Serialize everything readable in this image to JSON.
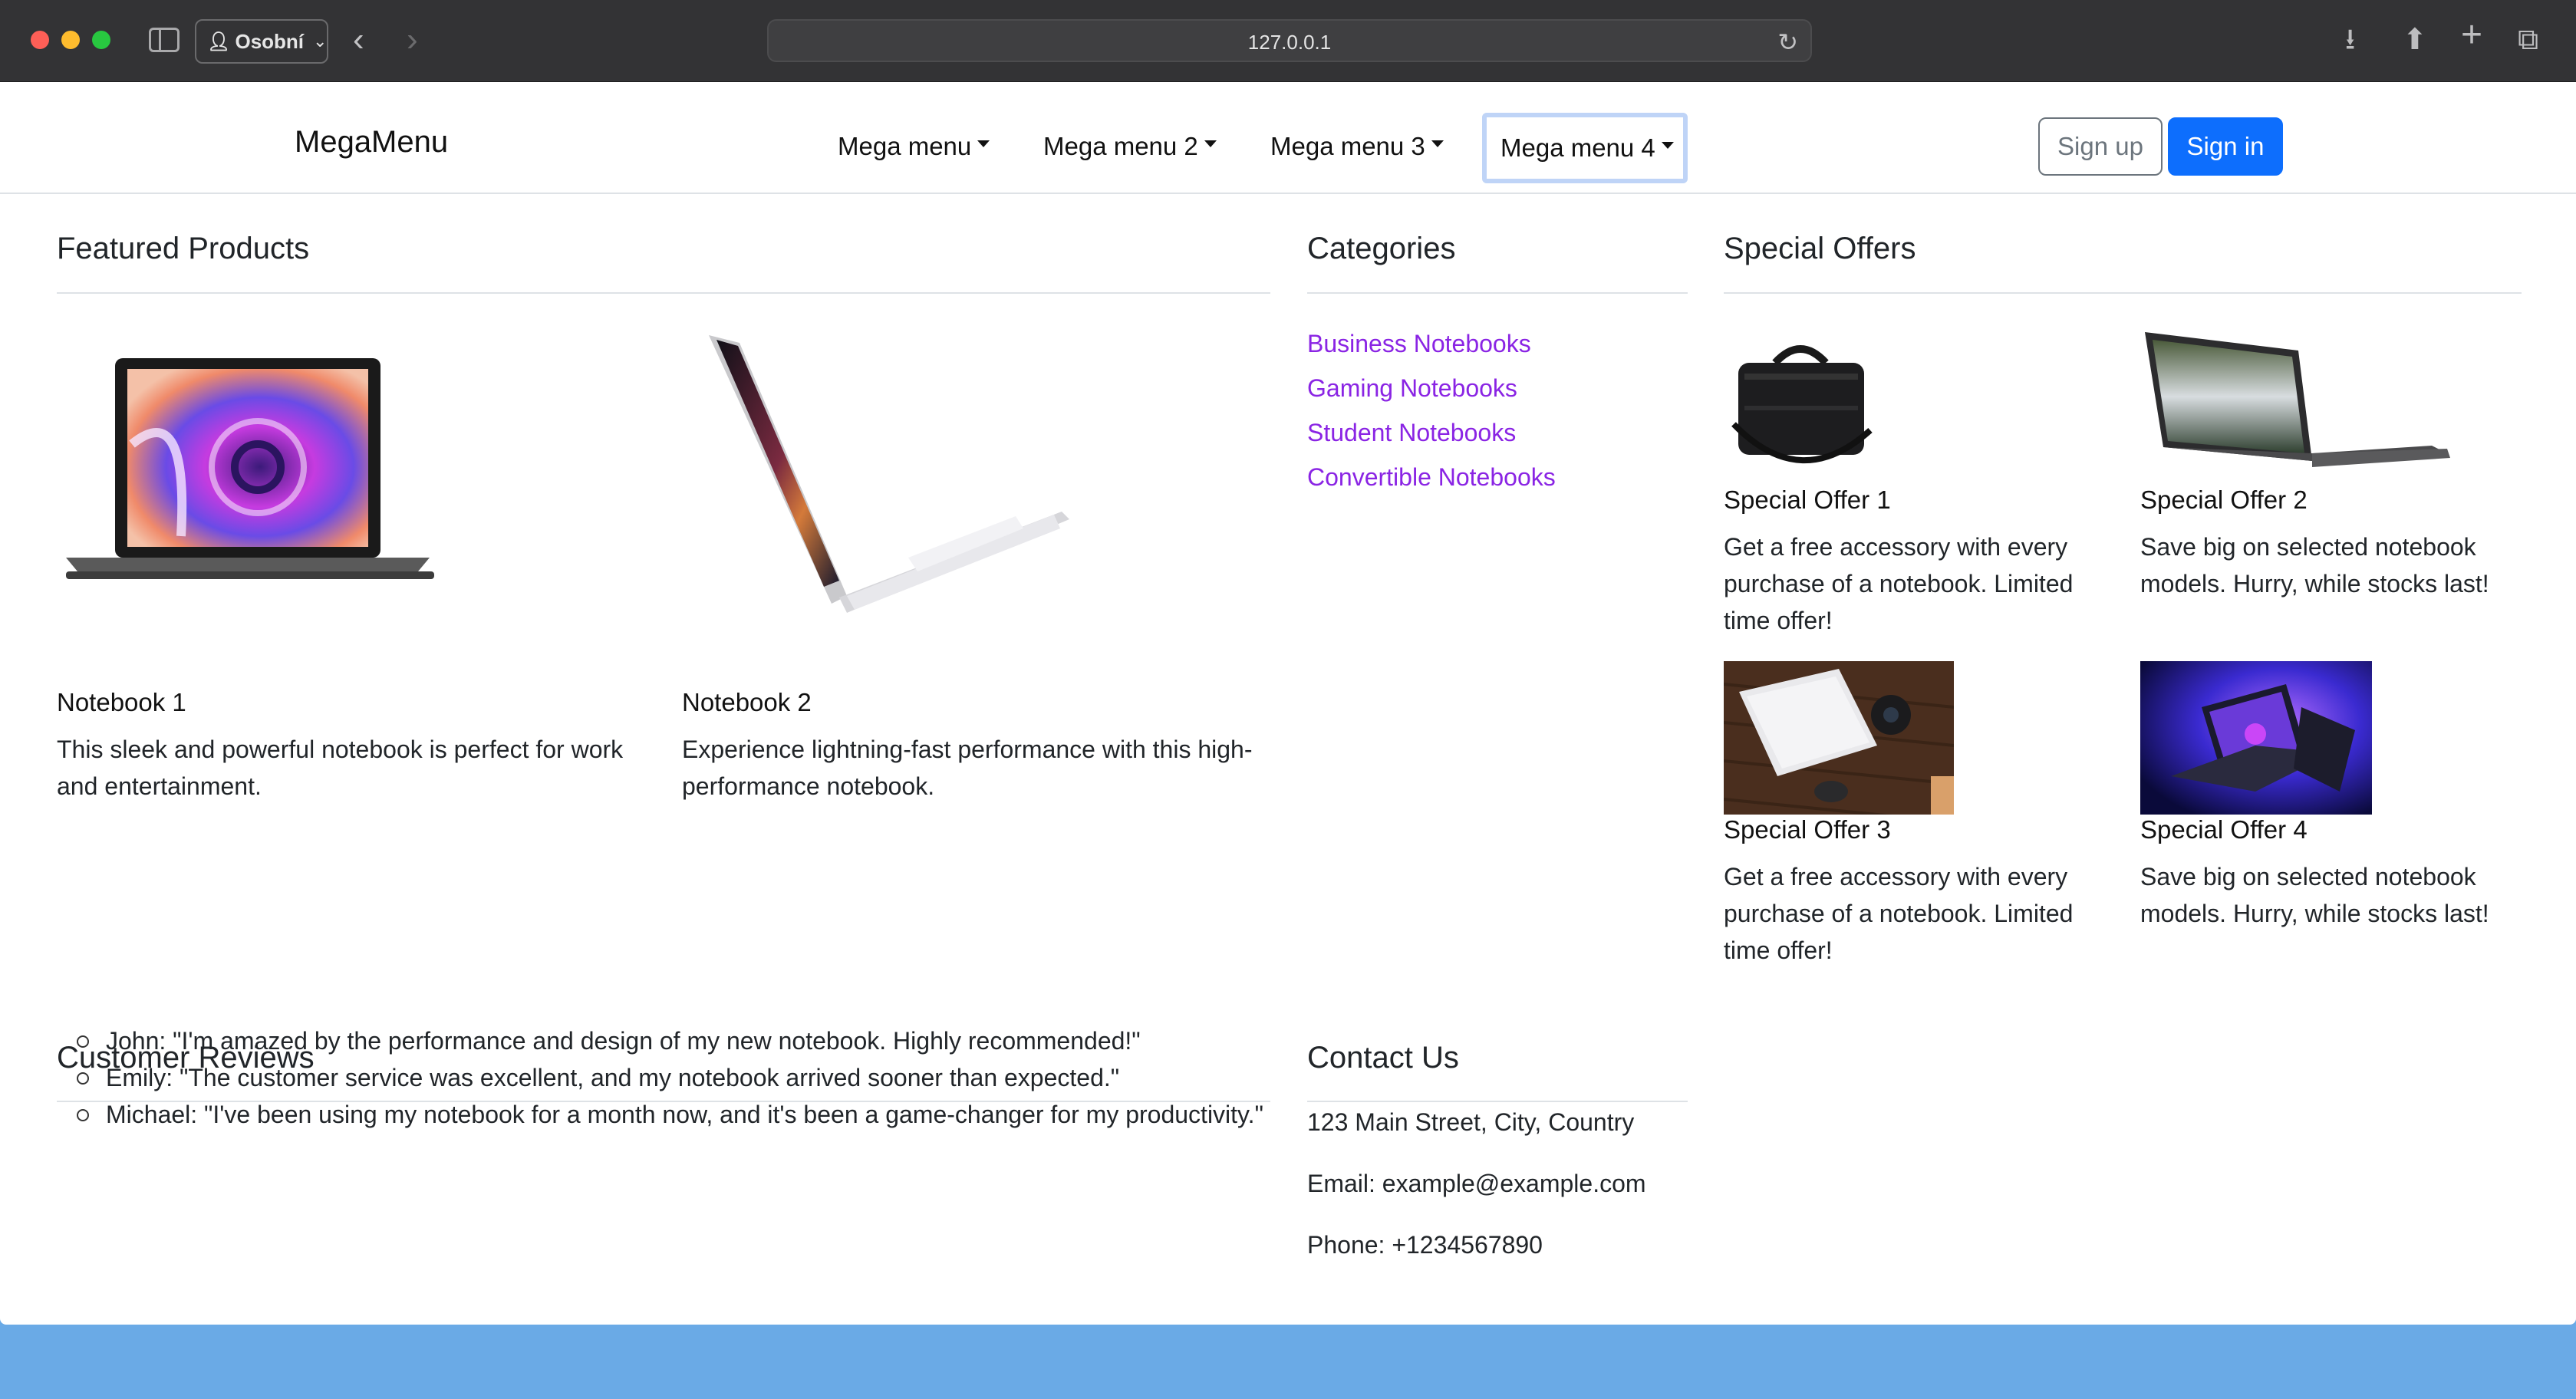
{
  "browser": {
    "profile_label": "Osobní",
    "url": "127.0.0.1"
  },
  "navbar": {
    "brand": "MegaMenu",
    "menus": [
      "Mega menu",
      "Mega menu 2",
      "Mega menu 3",
      "Mega menu 4"
    ],
    "signup": "Sign up",
    "signin": "Sign in"
  },
  "featured": {
    "title": "Featured Products",
    "items": [
      {
        "name": "Notebook 1",
        "text": "This sleek and powerful notebook is perfect for work and entertainment."
      },
      {
        "name": "Notebook 2",
        "text": "Experience lightning-fast performance with this high-performance notebook."
      }
    ]
  },
  "categories": {
    "title": "Categories",
    "links": [
      "Business Notebooks",
      "Gaming Notebooks",
      "Student Notebooks",
      "Convertible Notebooks"
    ]
  },
  "offers": {
    "title": "Special Offers",
    "items": [
      {
        "name": "Special Offer 1",
        "text": "Get a free accessory with every purchase of a notebook. Limited time offer!"
      },
      {
        "name": "Special Offer 2",
        "text": "Save big on selected notebook models. Hurry, while stocks last!"
      },
      {
        "name": "Special Offer 3",
        "text": "Get a free accessory with every purchase of a notebook. Limited time offer!"
      },
      {
        "name": "Special Offer 4",
        "text": "Save big on selected notebook models. Hurry, while stocks last!"
      }
    ]
  },
  "reviews": {
    "title": "Customer Reviews",
    "items": [
      "John: \"I'm amazed by the performance and design of my new notebook. Highly recommended!\"",
      "Emily: \"The customer service was excellent, and my notebook arrived sooner than expected.\"",
      "Michael: \"I've been using my notebook for a month now, and it's been a game-changer for my productivity.\""
    ]
  },
  "contact": {
    "title": "Contact Us",
    "address": "123 Main Street, City, Country",
    "email": "Email: example@example.com",
    "phone": "Phone: +1234567890"
  },
  "icons": {
    "profile": "person-icon",
    "back": "chevron-left-icon",
    "forward": "chevron-right-icon",
    "reload": "reload-icon",
    "download": "download-icon",
    "share": "share-icon",
    "new_tab": "plus-icon",
    "tabs": "tabs-overview-icon"
  }
}
